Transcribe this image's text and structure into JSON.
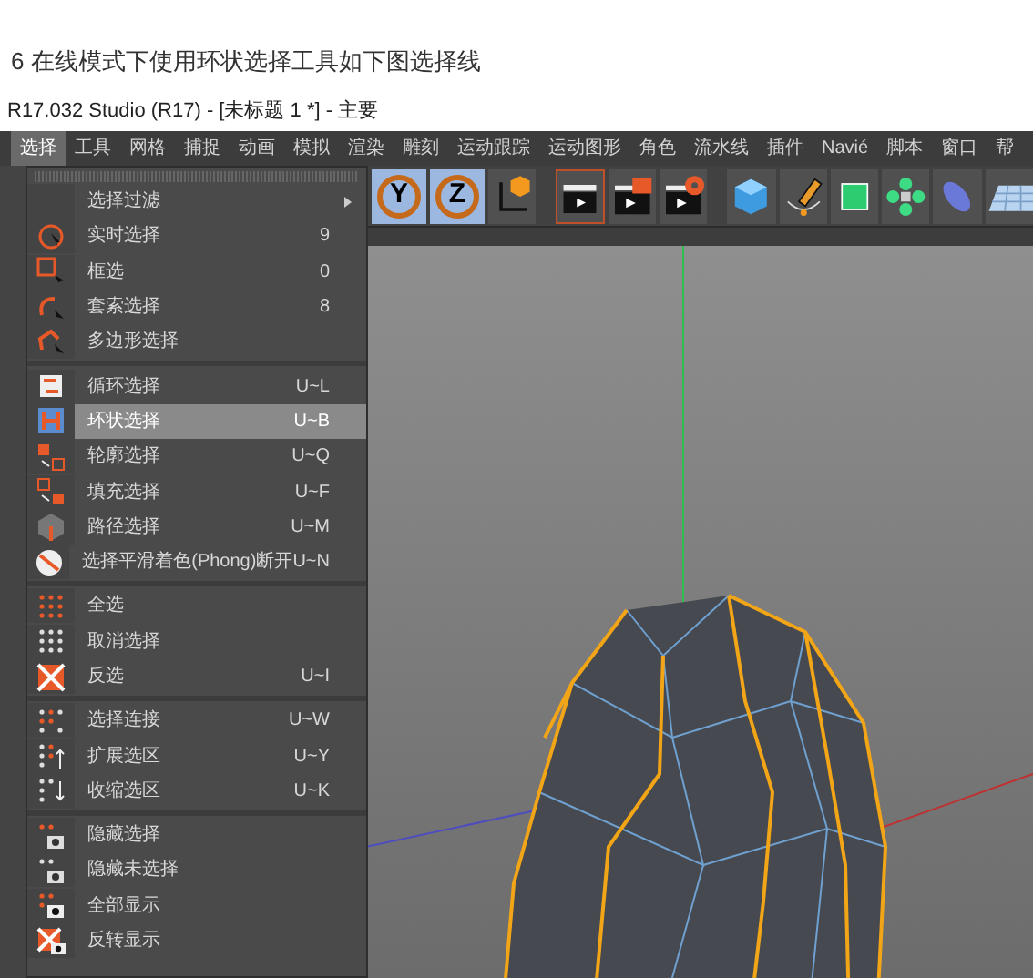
{
  "caption": "6 在线模式下使用环状选择工具如下图选择线",
  "window": {
    "title": "R17.032 Studio (R17) - [未标题 1 *] - 主要"
  },
  "menu_bar": [
    {
      "label": "选择",
      "selected": true
    },
    {
      "label": "工具",
      "selected": false
    },
    {
      "label": "网格",
      "selected": false
    },
    {
      "label": "捕捉",
      "selected": false
    },
    {
      "label": "动画",
      "selected": false
    },
    {
      "label": "模拟",
      "selected": false
    },
    {
      "label": "渲染",
      "selected": false
    },
    {
      "label": "雕刻",
      "selected": false
    },
    {
      "label": "运动跟踪",
      "selected": false
    },
    {
      "label": "运动图形",
      "selected": false
    },
    {
      "label": "角色",
      "selected": false
    },
    {
      "label": "流水线",
      "selected": false
    },
    {
      "label": "插件",
      "selected": false
    },
    {
      "label": "Navié",
      "selected": false
    },
    {
      "label": "脚本",
      "selected": false
    },
    {
      "label": "窗口",
      "selected": false
    },
    {
      "label": "帮",
      "selected": false
    }
  ],
  "toolbar": [
    {
      "label": "Y"
    },
    {
      "label": "Z"
    }
  ],
  "dropdown": {
    "sections": [
      {
        "items": [
          {
            "label": "选择过滤",
            "kind": "submenu",
            "selected": false
          },
          {
            "label": "实时选择",
            "shortcut": "9",
            "kind": "command",
            "selected": false
          },
          {
            "label": "框选",
            "shortcut": "0",
            "kind": "command",
            "selected": false
          },
          {
            "label": "套索选择",
            "shortcut": "8",
            "kind": "command",
            "selected": false
          },
          {
            "label": "多边形选择",
            "kind": "command",
            "selected": false
          }
        ]
      },
      {
        "items": [
          {
            "label": "循环选择",
            "shortcut": "U~L",
            "kind": "command",
            "selected": false
          },
          {
            "label": "环状选择",
            "shortcut": "U~B",
            "kind": "command",
            "selected": true
          },
          {
            "label": "轮廓选择",
            "shortcut": "U~Q",
            "kind": "command",
            "selected": false
          },
          {
            "label": "填充选择",
            "shortcut": "U~F",
            "kind": "command",
            "selected": false
          },
          {
            "label": "路径选择",
            "shortcut": "U~M",
            "kind": "command",
            "selected": false
          },
          {
            "label": "选择平滑着色(Phong)断开",
            "shortcut": "U~N",
            "kind": "command",
            "selected": false
          }
        ]
      },
      {
        "items": [
          {
            "label": "全选",
            "kind": "command",
            "selected": false
          },
          {
            "label": "取消选择",
            "kind": "command",
            "selected": false
          },
          {
            "label": "反选",
            "shortcut": "U~I",
            "kind": "command",
            "selected": false
          }
        ]
      },
      {
        "items": [
          {
            "label": "选择连接",
            "shortcut": "U~W",
            "kind": "command",
            "selected": false
          },
          {
            "label": "扩展选区",
            "shortcut": "U~Y",
            "kind": "command",
            "selected": false
          },
          {
            "label": "收缩选区",
            "shortcut": "U~K",
            "kind": "command",
            "selected": false
          }
        ]
      },
      {
        "items": [
          {
            "label": "隐藏选择",
            "kind": "command",
            "selected": false
          },
          {
            "label": "隐藏未选择",
            "kind": "command",
            "selected": false
          },
          {
            "label": "全部显示",
            "kind": "command",
            "selected": false
          },
          {
            "label": "反转显示",
            "kind": "command",
            "selected": false
          }
        ]
      }
    ]
  }
}
